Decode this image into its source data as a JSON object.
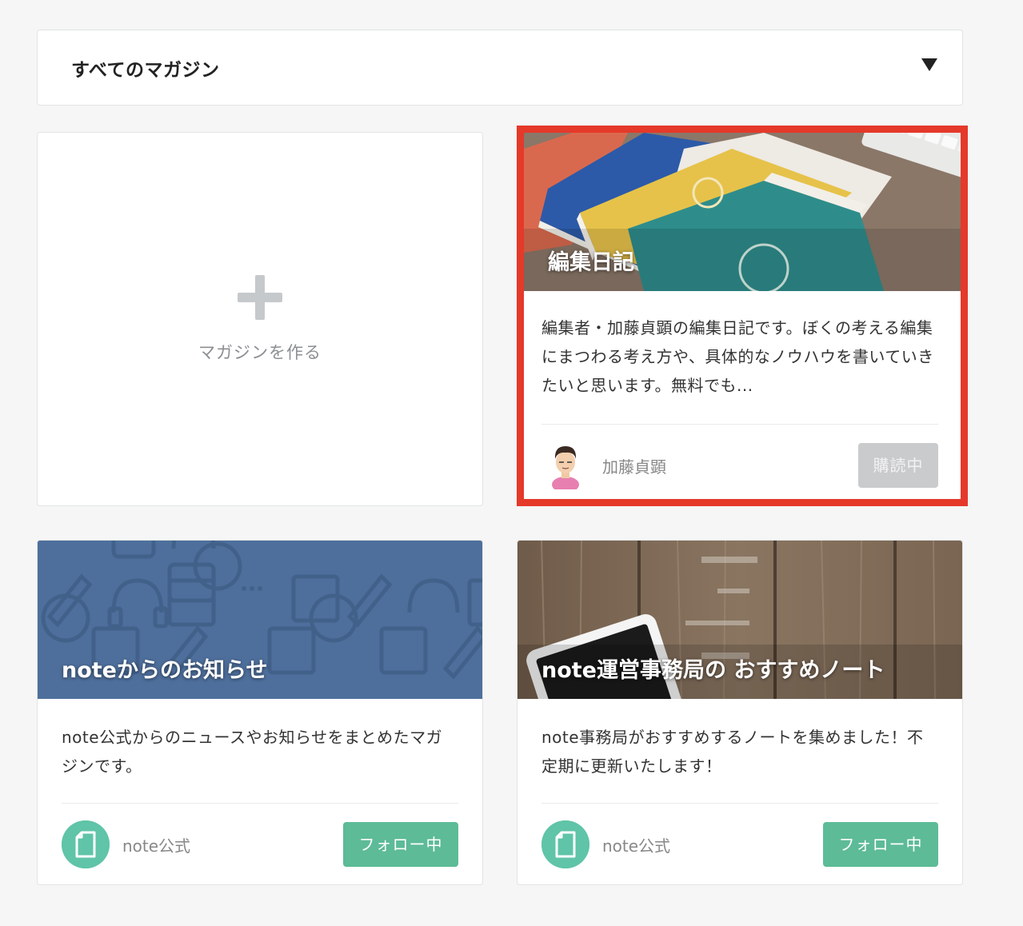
{
  "magazine_filter": {
    "selected": "すべてのマガジン",
    "icon": "triangle-down-icon"
  },
  "create_card": {
    "label": "マガジンを作る",
    "icon": "plus-icon"
  },
  "magazines": [
    {
      "title": "編集日記",
      "description": "編集者・加藤貞顕の編集日記です。ぼくの考える編集にまつわる考え方や、具体的なノウハウを書いていきたいと思います。無料でも...",
      "owner": "加藤貞顕",
      "button": "購読中",
      "highlighted": true
    },
    {
      "title": "noteからのお知らせ",
      "description": "note公式からのニュースやお知らせをまとめたマガジンです。",
      "owner": "note公式",
      "button": "フォロー中"
    },
    {
      "title": "note運営事務局の おすすめノート",
      "description": "note事務局がおすすめするノートを集めました！不定期に更新いたします！",
      "owner": "note公式",
      "button": "フォロー中"
    }
  ],
  "colors": {
    "highlight": "#e5392a",
    "follow_button": "#5dbb97",
    "subscribed_button": "#c9cbcd",
    "note_cover": "#4e6f9c"
  }
}
